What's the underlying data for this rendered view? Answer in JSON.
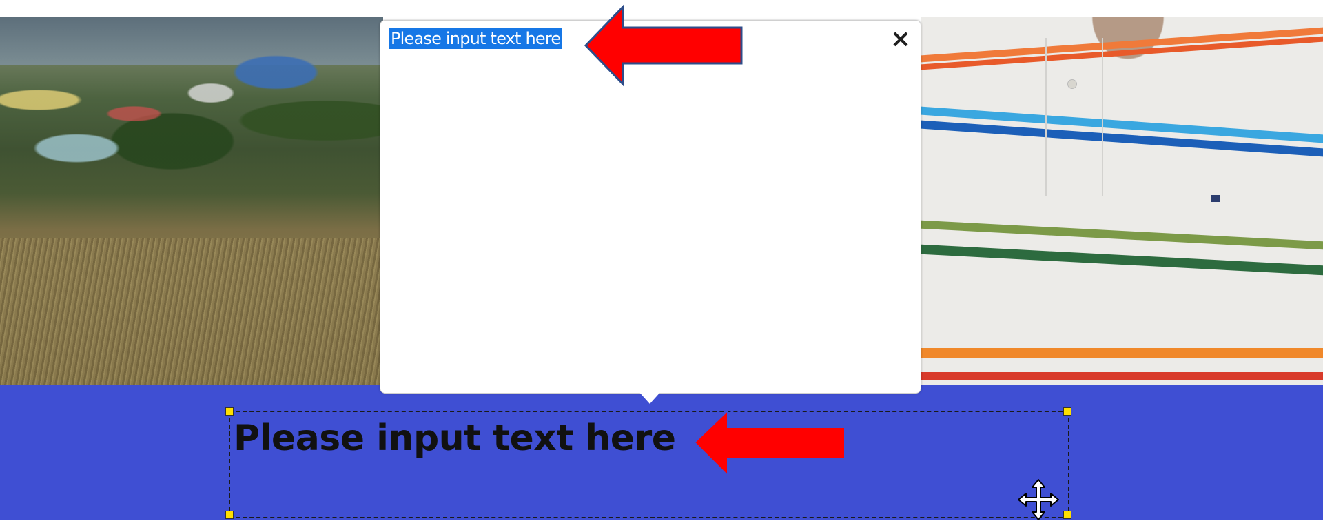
{
  "popup": {
    "text_value": "Please input text here",
    "close_icon": "close-icon"
  },
  "caption": {
    "text": "Please input text here"
  },
  "icons": {
    "annotation_arrow": "red-arrow-icon",
    "move_cursor": "move-cursor-icon"
  },
  "colors": {
    "band": "#3f4fd3",
    "selection": "#1677e6",
    "arrow": "#ff0000",
    "handle": "#ffe000"
  }
}
